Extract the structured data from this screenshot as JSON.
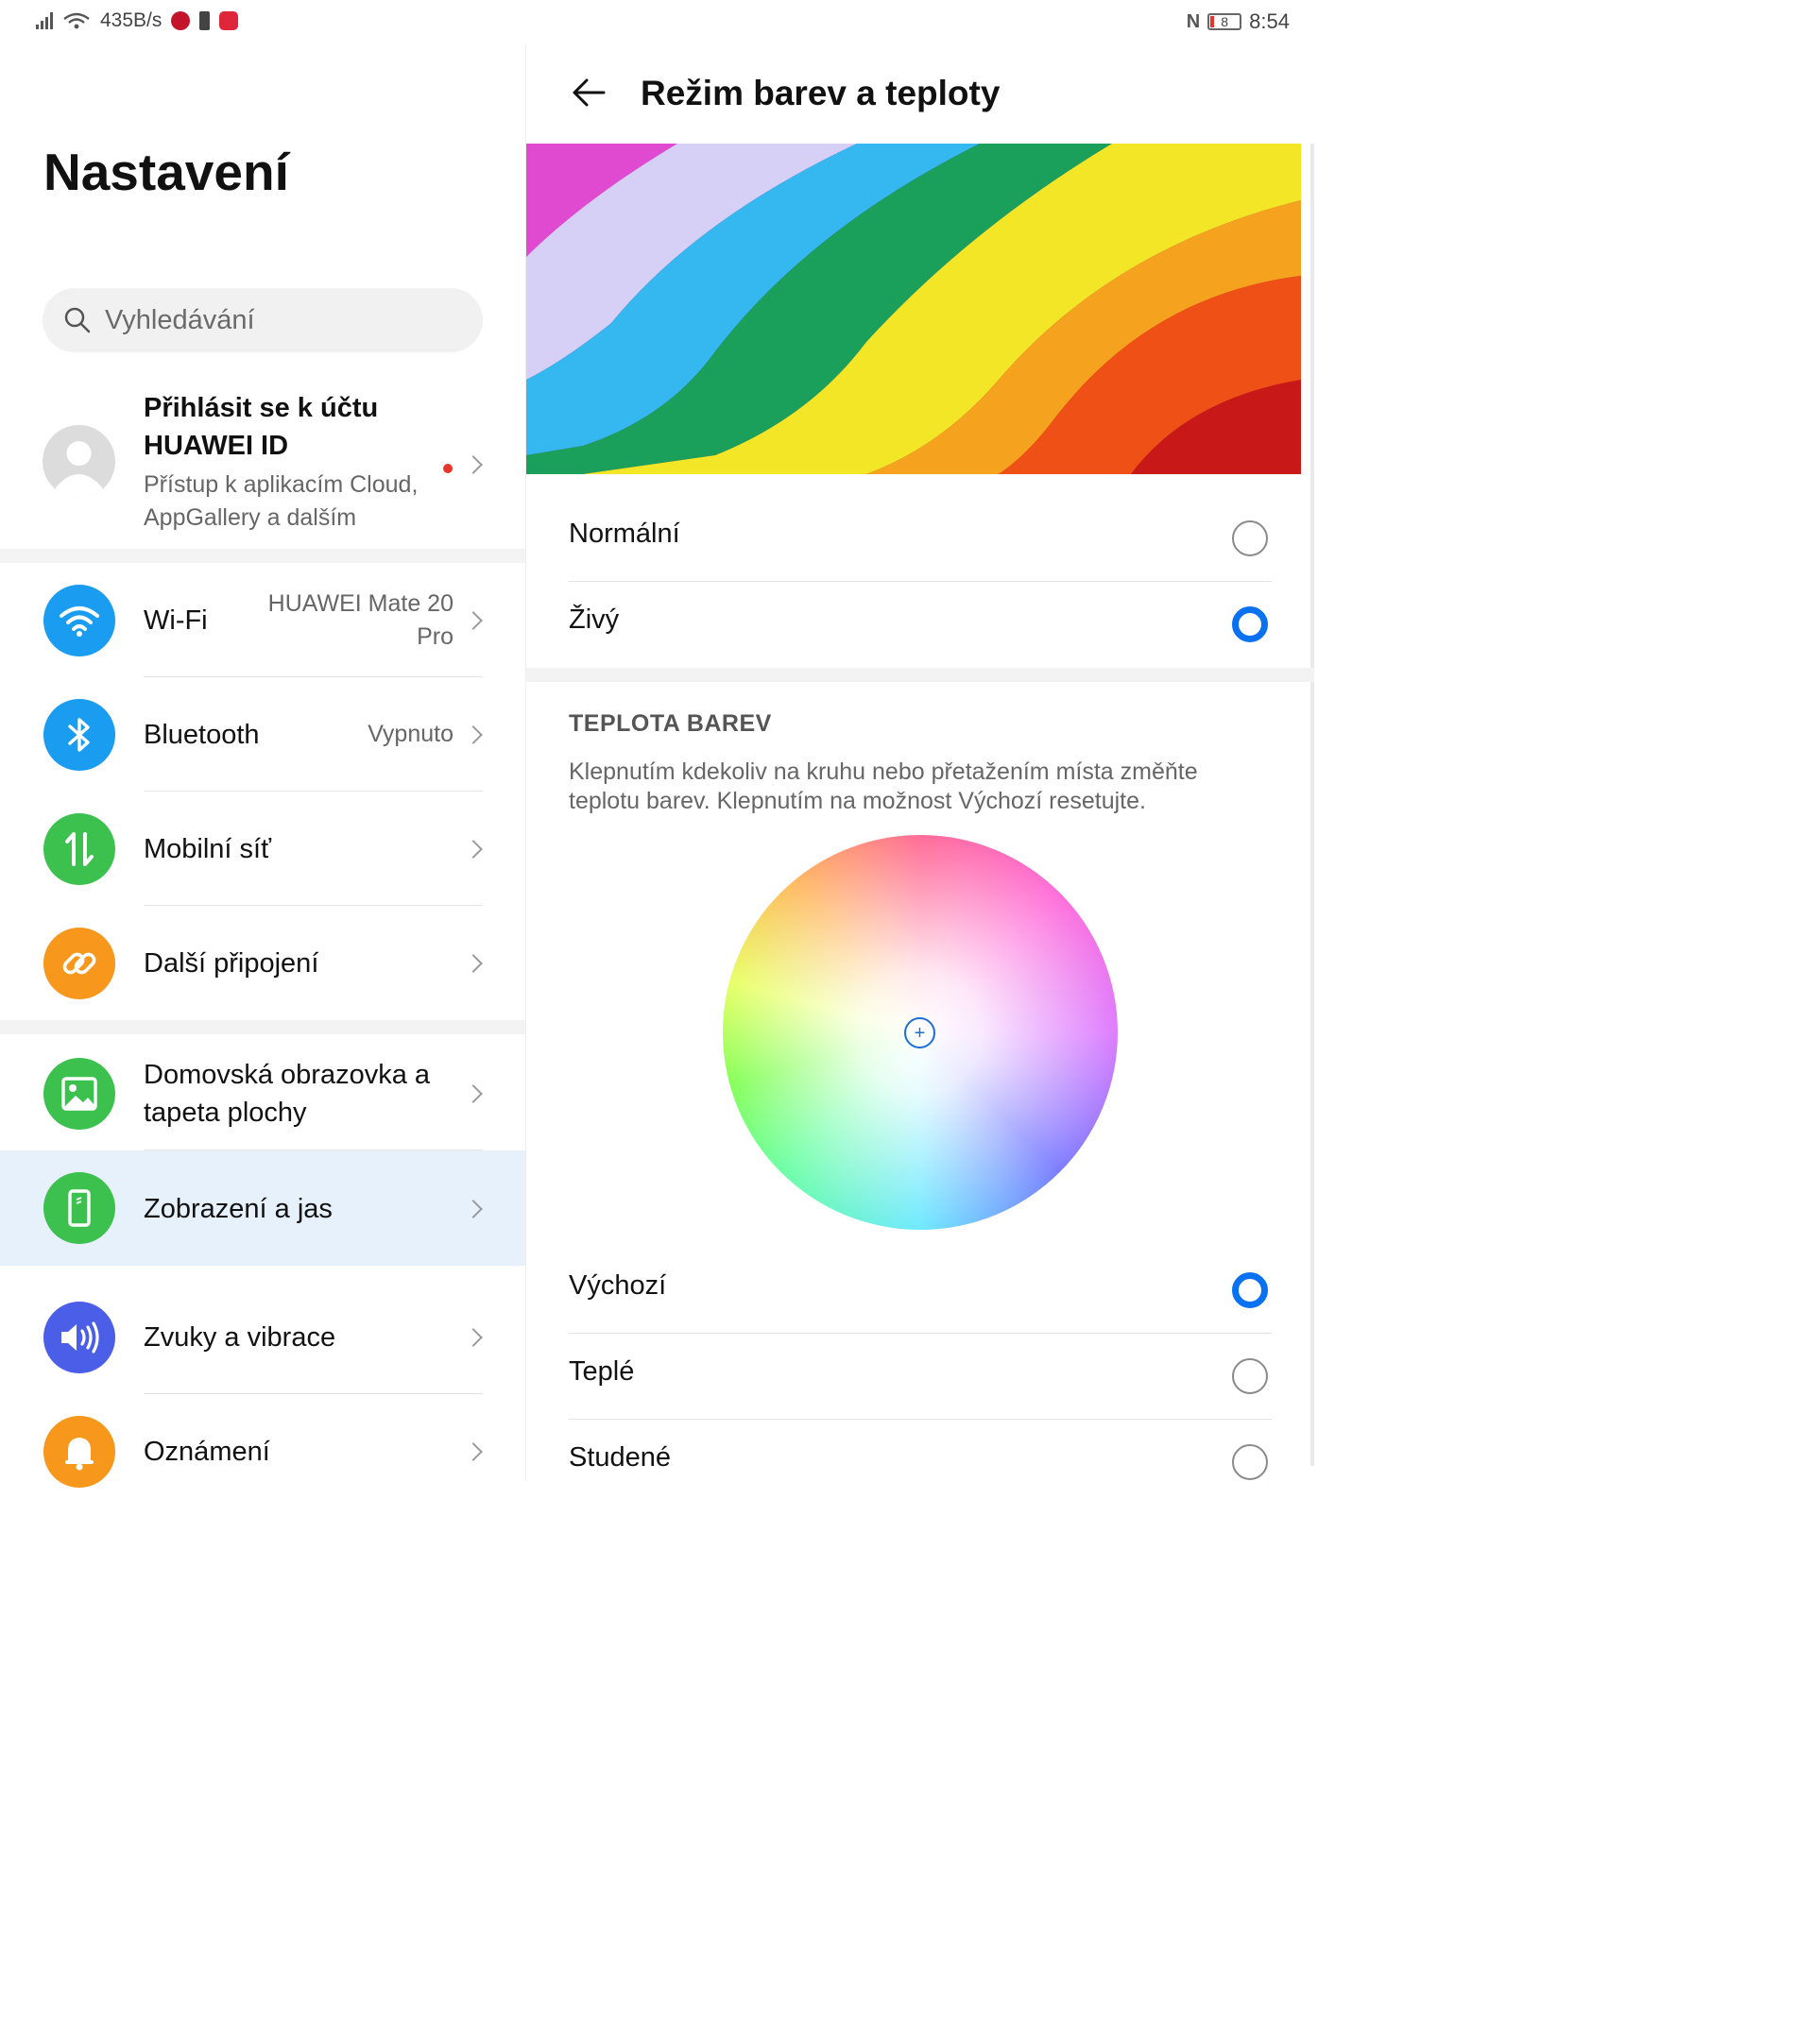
{
  "status_bar": {
    "net_speed": "435B/s",
    "battery": "8",
    "time": "8:54"
  },
  "left": {
    "title": "Nastavení",
    "search": {
      "placeholder": "Vyhledávání"
    },
    "account": {
      "title": "Přihlásit se k účtu HUAWEI ID",
      "subtitle": "Přístup k aplikacím Cloud, AppGallery a dalším"
    },
    "items": [
      {
        "label": "Wi-Fi",
        "value": "HUAWEI Mate 20 Pro",
        "icon": "wifi-icon",
        "color": "#1a9cf0"
      },
      {
        "label": "Bluetooth",
        "value": "Vypnuto",
        "icon": "bluetooth-icon",
        "color": "#1a9cf0"
      },
      {
        "label": "Mobilní síť",
        "value": "",
        "icon": "mobile-data-icon",
        "color": "#3cc14f"
      },
      {
        "label": "Další připojení",
        "value": "",
        "icon": "link-icon",
        "color": "#f7971b"
      },
      {
        "label": "Domovská obrazovka a tapeta plochy",
        "value": "",
        "icon": "wallpaper-icon",
        "color": "#3cc14f"
      },
      {
        "label": "Zobrazení a jas",
        "value": "",
        "icon": "display-icon",
        "color": "#3cc14f"
      },
      {
        "label": "Zvuky a vibrace",
        "value": "",
        "icon": "sound-icon",
        "color": "#4a5ee8"
      },
      {
        "label": "Oznámení",
        "value": "",
        "icon": "bell-icon",
        "color": "#f7971b"
      }
    ]
  },
  "right": {
    "title": "Režim barev a teploty",
    "modes": [
      {
        "label": "Normální",
        "selected": false
      },
      {
        "label": "Živý",
        "selected": true
      }
    ],
    "temperature": {
      "section_title": "TEPLOTA BAREV",
      "description": "Klepnutím kdekoliv na kruhu nebo přetažením místa změňte teplotu barev. Klepnutím na možnost Výchozí resetujte.",
      "options": [
        {
          "label": "Výchozí",
          "selected": true
        },
        {
          "label": "Teplé",
          "selected": false
        },
        {
          "label": "Studené",
          "selected": false
        }
      ]
    }
  },
  "colors": {
    "accent": "#0a72f0",
    "selected_row_bg": "#e6f1fc"
  }
}
